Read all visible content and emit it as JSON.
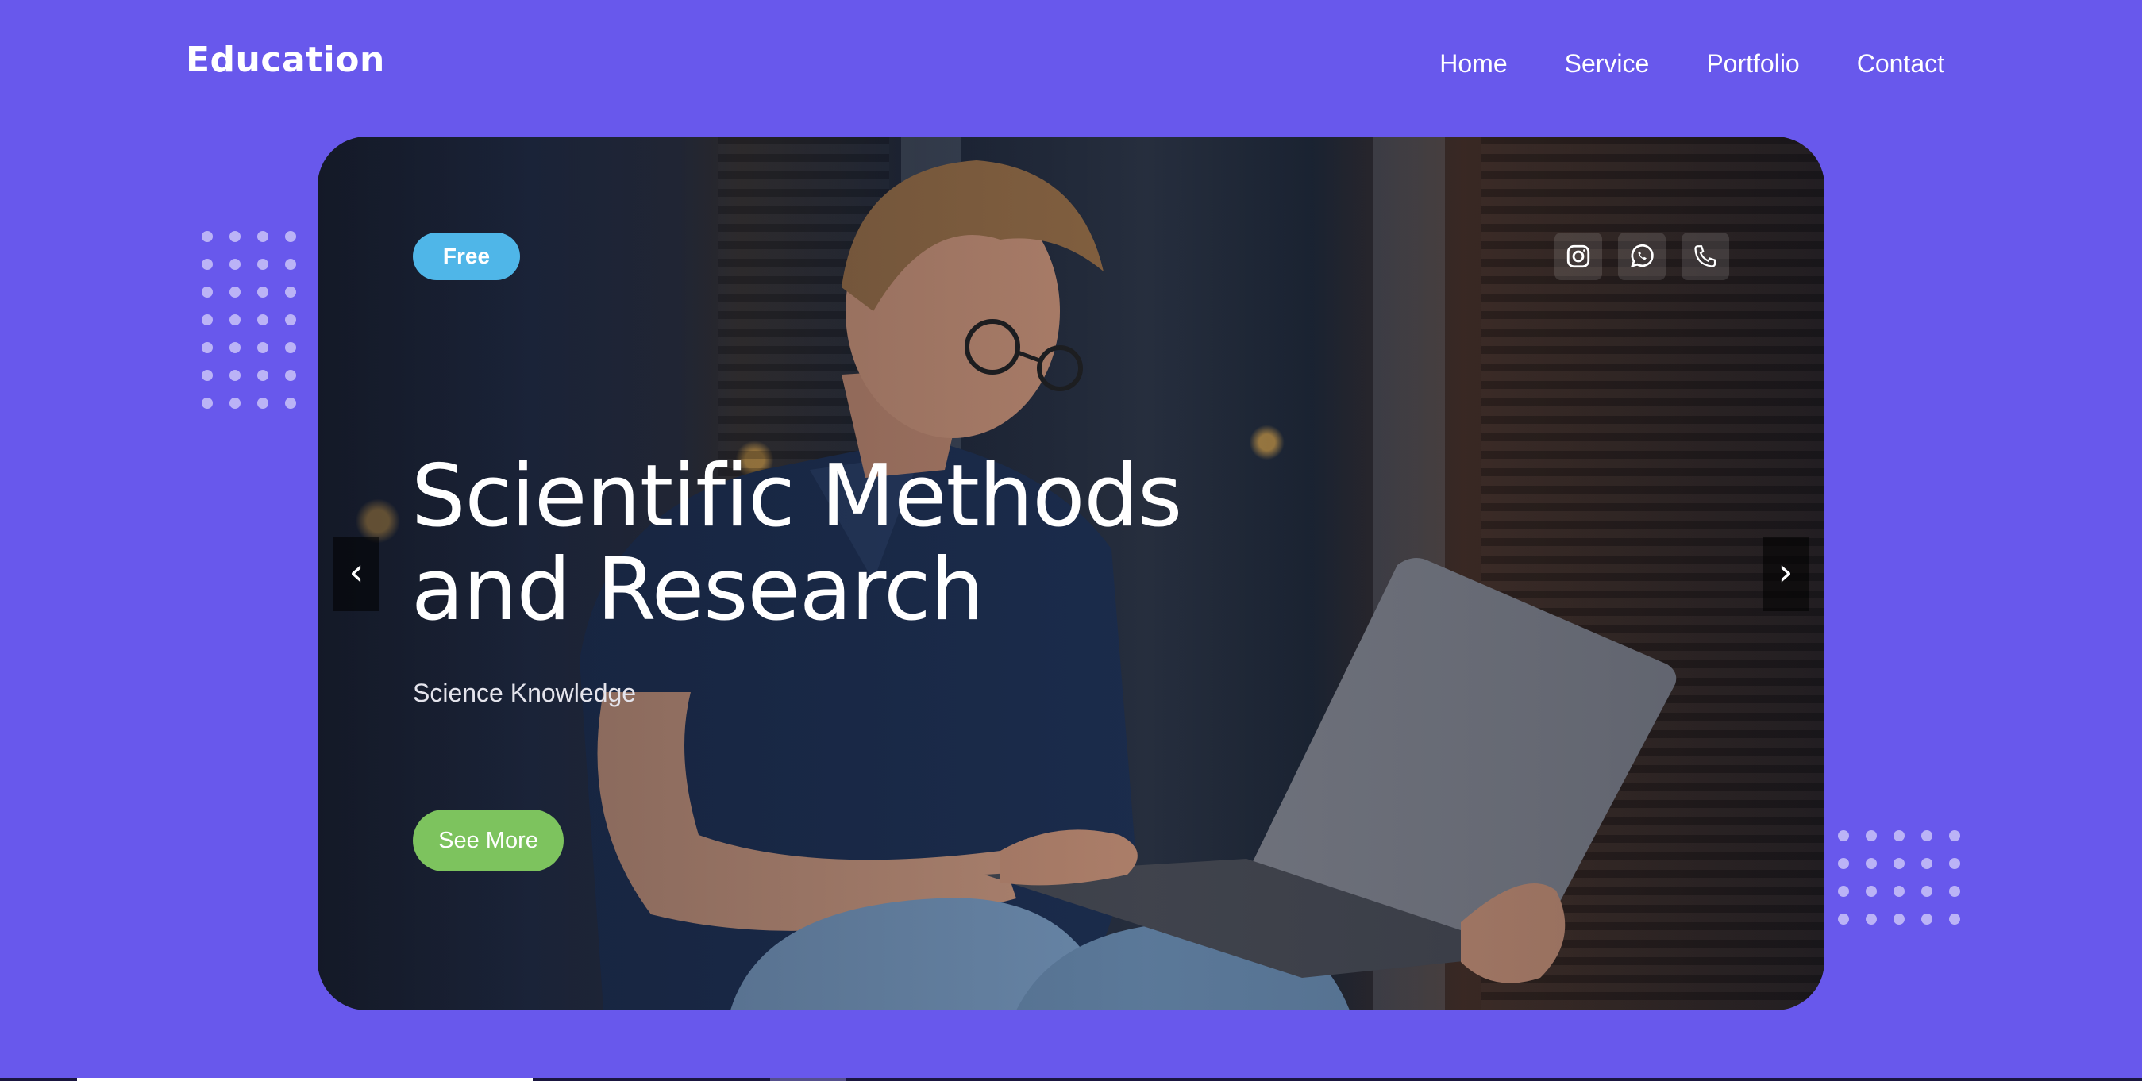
{
  "header": {
    "logo": "Education",
    "nav": [
      "Home",
      "Service",
      "Portfolio",
      "Contact"
    ]
  },
  "hero": {
    "badge": "Free",
    "title_line1": "Scientific Methods",
    "title_line2": "and Research",
    "subtitle": "Science Knowledge",
    "cta": "See More",
    "prev": "‹",
    "next": "›",
    "social_icons": [
      "instagram-icon",
      "whatsapp-icon",
      "phone-icon"
    ]
  },
  "colors": {
    "background": "#6858EC",
    "badge": "#4FB6E8",
    "cta": "#7DC35E",
    "text": "#ffffff"
  }
}
